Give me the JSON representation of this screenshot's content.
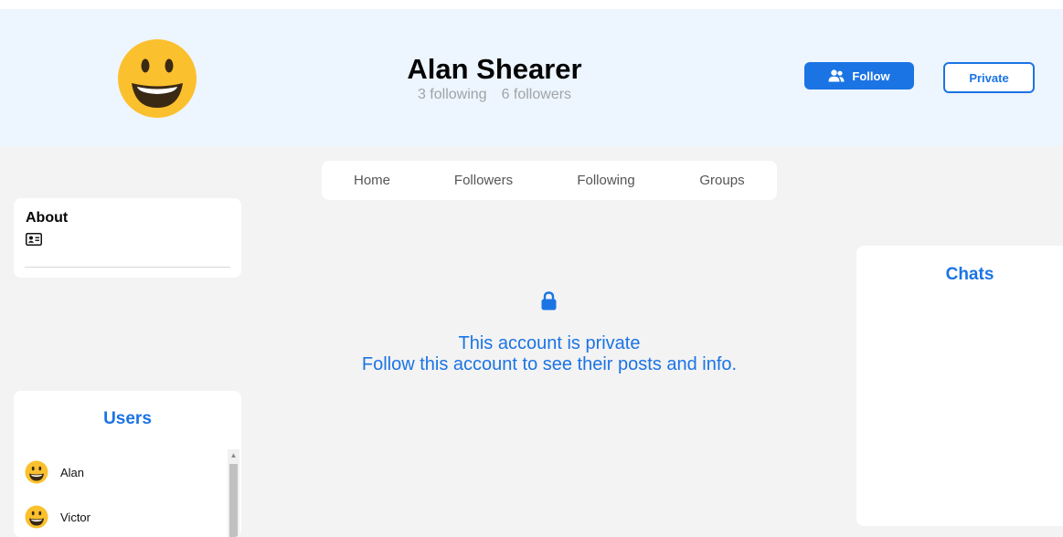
{
  "profile": {
    "name": "Alan Shearer",
    "following": "3 following",
    "followers": "6 followers",
    "avatar_icon": "grinning-face-icon"
  },
  "actions": {
    "follow_label": "Follow",
    "follow_icon": "user-group-icon",
    "privacy_label": "Private"
  },
  "tabs": [
    {
      "label": "Home"
    },
    {
      "label": "Followers"
    },
    {
      "label": "Following"
    },
    {
      "label": "Groups"
    }
  ],
  "about": {
    "title": "About",
    "icon": "id-card-icon"
  },
  "private_notice": {
    "icon": "lock-icon",
    "line1": "This account is private",
    "line2": "Follow this account to see their posts and info."
  },
  "users": {
    "title": "Users",
    "items": [
      {
        "name": "Alan"
      },
      {
        "name": "Victor"
      }
    ]
  },
  "chats": {
    "title": "Chats"
  },
  "colors": {
    "accent": "#1b74e4",
    "header_bg": "#edf5fe",
    "page_bg": "#f3f3f3",
    "emoji_yellow": "#fbc02d"
  }
}
